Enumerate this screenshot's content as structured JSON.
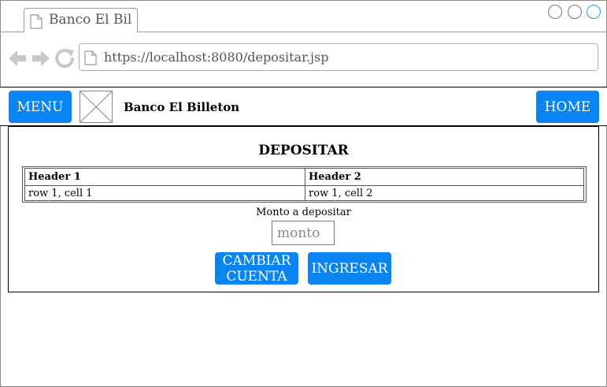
{
  "browser": {
    "tab_title": "Banco El Bil",
    "url": "https://localhost:8080/depositar.jsp"
  },
  "header": {
    "menu_label": "MENU",
    "brand": "Banco El Billeton",
    "home_label": "HOME"
  },
  "main": {
    "title": "DEPOSITAR",
    "table": {
      "headers": [
        "Header 1",
        "Header 2"
      ],
      "rows": [
        [
          "row 1, cell 1",
          "row 1, cell 2"
        ]
      ]
    },
    "amount_label": "Monto a depositar",
    "amount_placeholder": "monto",
    "change_account_label": "CAMBIAR CUENTA",
    "deposit_label": "INGRESAR"
  },
  "colors": {
    "button": "#0a84f0",
    "window_button_active": "#1a9be8"
  }
}
